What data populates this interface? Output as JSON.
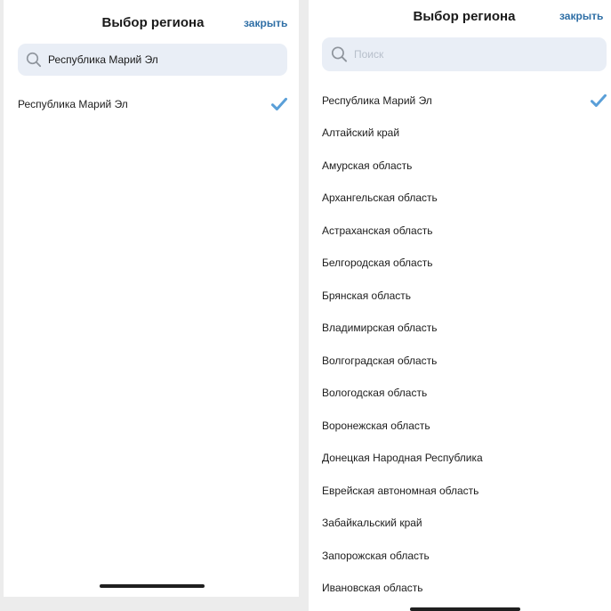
{
  "left": {
    "title": "Выбор региона",
    "close_label": "закрыть",
    "search": {
      "value": "Республика Марий Эл"
    },
    "results": [
      {
        "label": "Республика Марий Эл",
        "selected": true
      }
    ]
  },
  "right": {
    "title": "Выбор региона",
    "close_label": "закрыть",
    "search": {
      "placeholder": "Поиск"
    },
    "regions": [
      {
        "label": "Республика Марий Эл",
        "selected": true
      },
      {
        "label": "Алтайский край"
      },
      {
        "label": "Амурская область"
      },
      {
        "label": "Архангельская область"
      },
      {
        "label": "Астраханская область"
      },
      {
        "label": "Белгородская область"
      },
      {
        "label": "Брянская область"
      },
      {
        "label": "Владимирская область"
      },
      {
        "label": "Волгоградская область"
      },
      {
        "label": "Вологодская область"
      },
      {
        "label": "Воронежская область"
      },
      {
        "label": "Донецкая Народная Республика"
      },
      {
        "label": "Еврейская автономная область"
      },
      {
        "label": "Забайкальский край"
      },
      {
        "label": "Запорожская область"
      },
      {
        "label": "Ивановская область"
      }
    ]
  },
  "colors": {
    "accent": "#2f6fa6",
    "check": "#5a9fd8",
    "search_bg": "#e9eef6"
  },
  "icons": {
    "search": "magnifier-icon",
    "selected": "checkmark-icon"
  }
}
